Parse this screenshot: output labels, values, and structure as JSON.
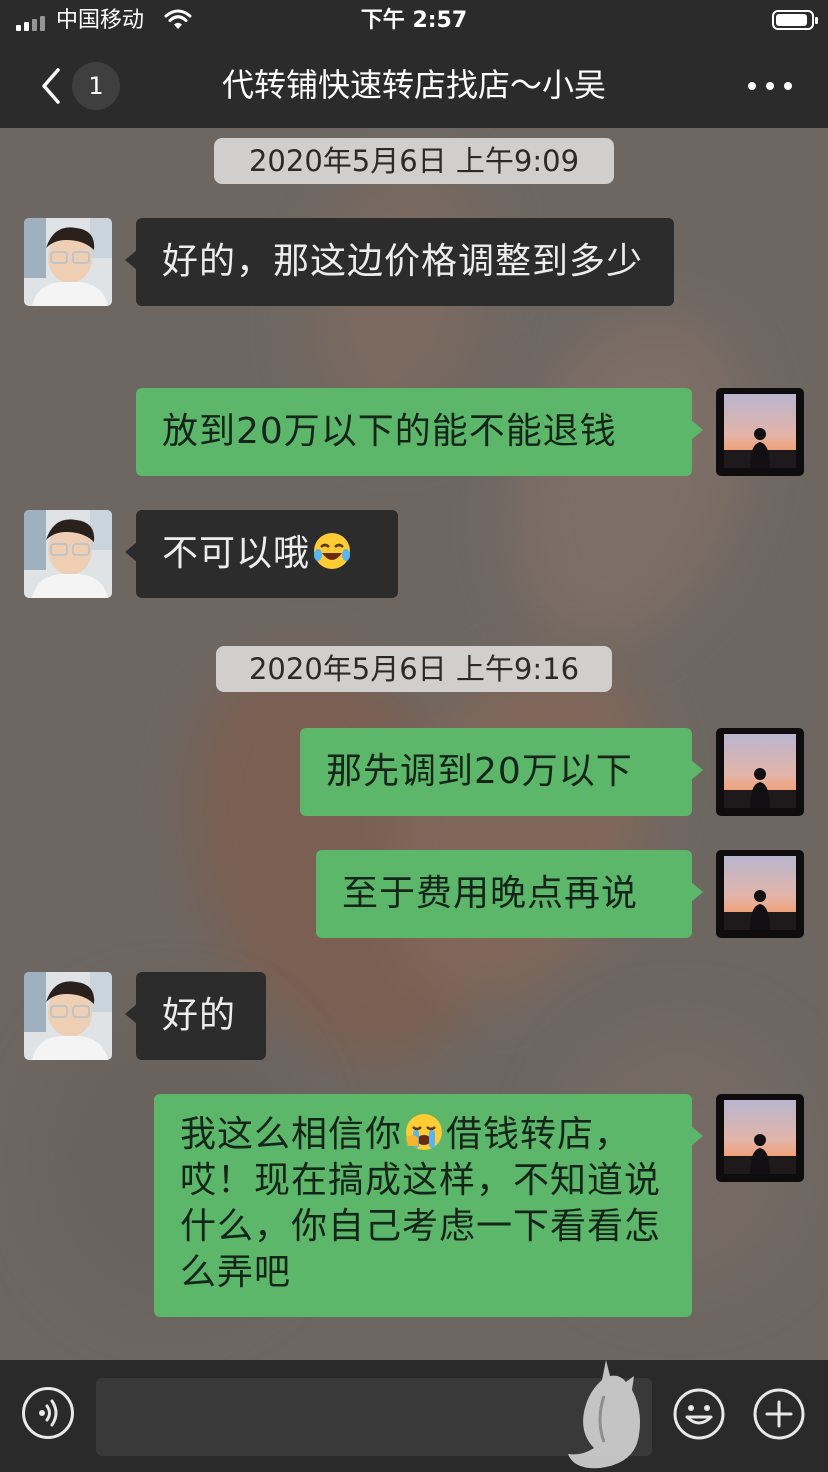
{
  "status_bar": {
    "carrier": "中国移动",
    "time": "下午 2:57",
    "battery_level": 0.92
  },
  "nav": {
    "unread_count": "1",
    "title": "代转铺快速转店找店～小吴"
  },
  "messages": [
    {
      "type": "time",
      "text": "2020年5月6日 上午9:09"
    },
    {
      "type": "in",
      "sender": "contact",
      "text": "好的，那这边价格调整到多少"
    },
    {
      "type": "out",
      "sender": "self",
      "text": "放到20万以下的能不能退钱"
    },
    {
      "type": "in",
      "sender": "contact",
      "text": "不可以哦",
      "emoji": "tears-of-joy"
    },
    {
      "type": "time",
      "text": "2020年5月6日 上午9:16"
    },
    {
      "type": "out",
      "sender": "self",
      "text": "那先调到20万以下"
    },
    {
      "type": "out",
      "sender": "self",
      "text": "至于费用晚点再说"
    },
    {
      "type": "in",
      "sender": "contact",
      "text": "好的"
    },
    {
      "type": "out",
      "sender": "self",
      "text_before_emoji": "我这么相信你",
      "emoji": "loudly-crying",
      "text_after_emoji": "借钱转店，哎！现在搞成这样，不知道说什么，你自己考虑一下看看怎么弄吧"
    }
  ],
  "input_bar": {
    "value": "",
    "icons": [
      "voice-icon",
      "emoji-icon",
      "plus-icon"
    ]
  },
  "colors": {
    "nav_background": "#2b2b2b",
    "incoming_bubble": "#2c2c2c",
    "outgoing_bubble": "#5db76b",
    "time_label": "#d0cfcd"
  }
}
